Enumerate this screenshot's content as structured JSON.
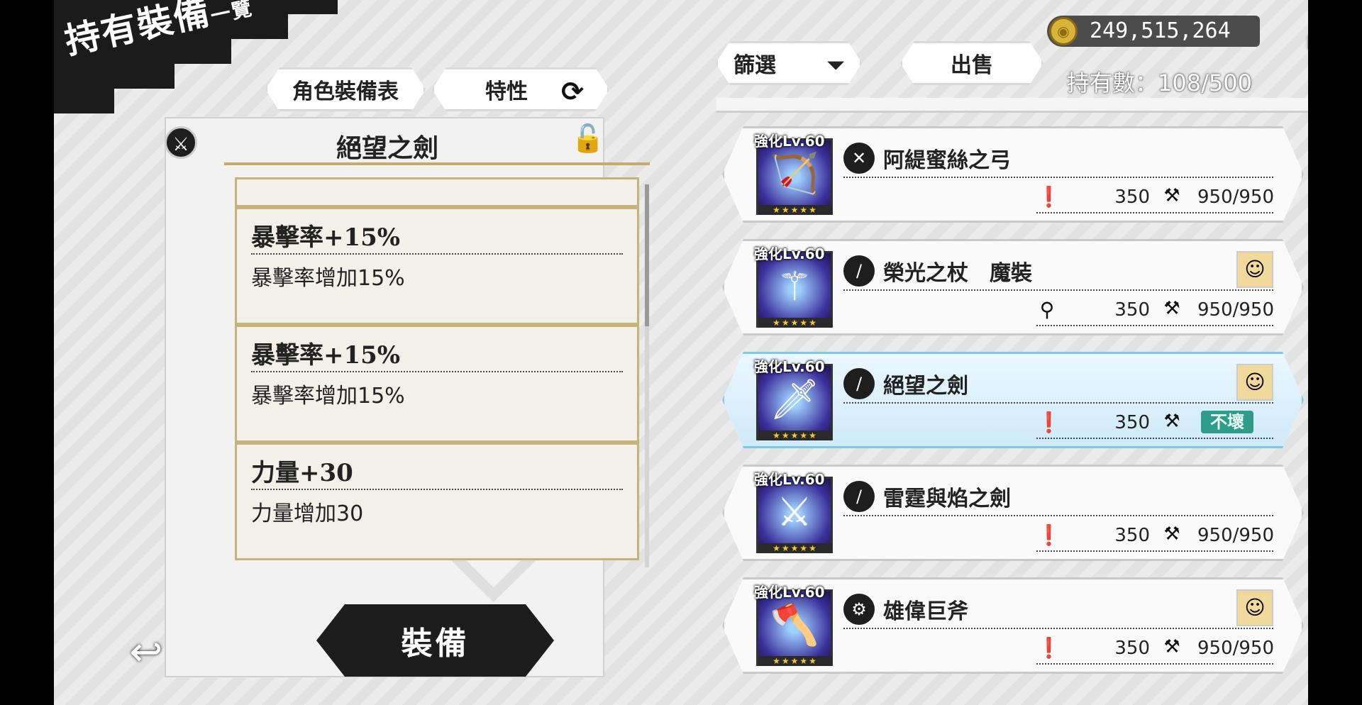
{
  "header": {
    "title_main": "持有裝備",
    "title_sub": "一覽"
  },
  "tabs": {
    "equip_table": "角色裝備表",
    "trait": "特性",
    "refresh_icon": "refresh-icon"
  },
  "detail": {
    "title": "絕望之劍",
    "traits": [
      {
        "name": "暴擊率+15%",
        "desc": "暴擊率增加15%"
      },
      {
        "name": "暴擊率+15%",
        "desc": "暴擊率增加15%"
      },
      {
        "name": "力量+30",
        "desc": "力量增加30"
      }
    ],
    "equip_button": "裝備"
  },
  "toolbar": {
    "filter_label": "篩選",
    "sell_label": "出售",
    "gold": "249,515,264",
    "owned_label": "持有數",
    "owned_count": "108/500"
  },
  "list": {
    "items": [
      {
        "level": "強化Lv.60",
        "type_icon": "bow-icon",
        "name": "阿緹蜜絲之弓",
        "stat_icon": "attack-icon",
        "power": "350",
        "durability": "950/950",
        "has_avatar": false
      },
      {
        "level": "強化Lv.60",
        "type_icon": "staff-icon",
        "name": "榮光之杖　魔裝",
        "stat_icon": "magic-icon",
        "power": "350",
        "durability": "950/950",
        "has_avatar": true
      },
      {
        "level": "強化Lv.60",
        "type_icon": "sword-icon",
        "name": "絕望之劍",
        "stat_icon": "attack-icon",
        "power": "350",
        "durability": "不壞",
        "has_avatar": true,
        "selected": true
      },
      {
        "level": "強化Lv.60",
        "type_icon": "sword-icon",
        "name": "雷霆與焰之劍",
        "stat_icon": "attack-icon",
        "power": "350",
        "durability": "950/950",
        "has_avatar": false
      },
      {
        "level": "強化Lv.60",
        "type_icon": "axe-icon",
        "name": "雄偉巨斧",
        "stat_icon": "attack-icon",
        "power": "350",
        "durability": "950/950",
        "has_avatar": true
      }
    ]
  }
}
